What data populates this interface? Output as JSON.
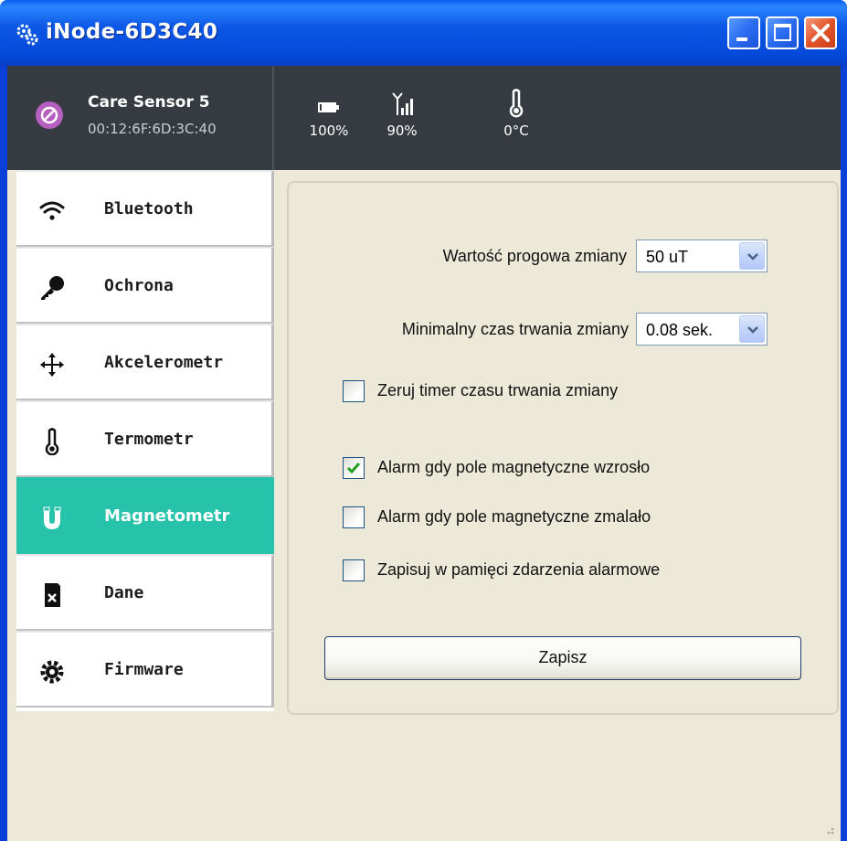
{
  "window": {
    "title": "iNode-6D3C40"
  },
  "device": {
    "name": "Care Sensor 5",
    "mac": "00:12:6F:6D:3C:40"
  },
  "stats": {
    "battery": "100%",
    "signal": "90%",
    "temperature": "0°C"
  },
  "sidebar": {
    "items": [
      {
        "label": "Bluetooth",
        "icon": "wifi-icon"
      },
      {
        "label": "Ochrona",
        "icon": "key-icon"
      },
      {
        "label": "Akcelerometr",
        "icon": "move-arrows-icon"
      },
      {
        "label": "Termometr",
        "icon": "thermometer-icon"
      },
      {
        "label": "Magnetometr",
        "icon": "magnet-icon",
        "active": true
      },
      {
        "label": "Dane",
        "icon": "sd-card-icon"
      },
      {
        "label": "Firmware",
        "icon": "gear-icon"
      }
    ]
  },
  "settings": {
    "threshold_label": "Wartość progowa zmiany",
    "threshold_value": "50 uT",
    "duration_label": "Minimalny czas trwania zmiany",
    "duration_value": "0.08 sek.",
    "checks": [
      {
        "label": "Zeruj timer czasu trwania zmiany",
        "checked": false
      },
      {
        "label": "Alarm gdy pole magnetyczne wzrosło",
        "checked": true
      },
      {
        "label": "Alarm gdy pole magnetyczne zmalało",
        "checked": false
      },
      {
        "label": "Zapisuj w pamięci zdarzenia alarmowe",
        "checked": false
      }
    ],
    "save_label": "Zapisz"
  },
  "colors": {
    "accent": "#26c3aa",
    "header": "#353b40",
    "titlebar": "#0a5ae6"
  }
}
